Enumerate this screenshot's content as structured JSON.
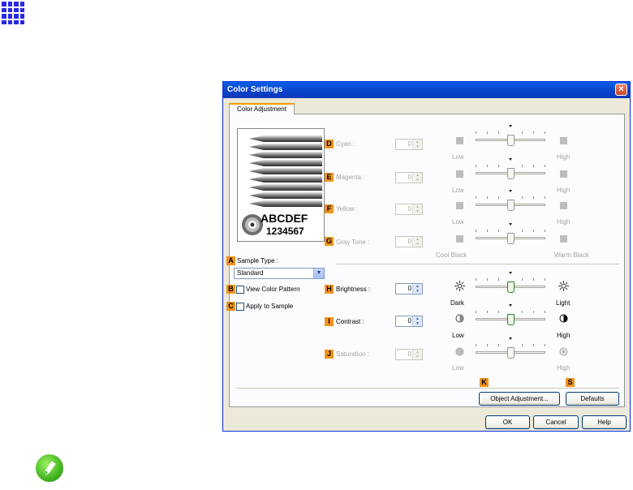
{
  "dialog": {
    "title": "Color Settings",
    "close_glyph": "×",
    "tab": "Color Adjustment"
  },
  "preview": {
    "text_line1": "ABCDEF",
    "text_line2": "1234567"
  },
  "badges": {
    "A": "A",
    "B": "B",
    "C": "C",
    "D": "D",
    "E": "E",
    "F": "F",
    "G": "G",
    "H": "H",
    "I": "I",
    "J": "J",
    "K": "K",
    "S": "S"
  },
  "left": {
    "sample_type_label": "Sample Type :",
    "sample_type_value": "Standard",
    "combo_arrow": "▼",
    "view_color_pattern": "View Color Pattern",
    "apply_to_sample": "Apply to Sample"
  },
  "controls": {
    "cyan": {
      "label": "Cyan :",
      "value": "0",
      "low": "Low",
      "high": "High",
      "level": 0.5
    },
    "magenta": {
      "label": "Magenta :",
      "value": "0",
      "low": "Low",
      "high": "High",
      "level": 0.5
    },
    "yellow": {
      "label": "Yellow :",
      "value": "0",
      "low": "Low",
      "high": "High",
      "level": 0.5
    },
    "gray_tone": {
      "label": "Gray Tone :",
      "value": "0",
      "low": "Cool Black",
      "high": "Warm Black",
      "level": 0.5
    },
    "brightness": {
      "label": "Brightness :",
      "value": "0",
      "low": "Dark",
      "high": "Light",
      "level": 0.5
    },
    "contrast": {
      "label": "Contrast :",
      "value": "0",
      "low": "Low",
      "high": "High",
      "level": 0.5
    },
    "saturation": {
      "label": "Saturation :",
      "value": "0",
      "low": "Low",
      "high": "High",
      "level": 0.5
    }
  },
  "spin_glyphs": {
    "up": "▲",
    "down": "▼"
  },
  "buttons": {
    "object_adjustment": "Object Adjustment...",
    "defaults": "Defaults",
    "ok": "OK",
    "cancel": "Cancel",
    "help": "Help"
  },
  "colors": {
    "badge": "#f0931e",
    "titlebar": "#0842c9",
    "note_icon": "#3db01c"
  }
}
